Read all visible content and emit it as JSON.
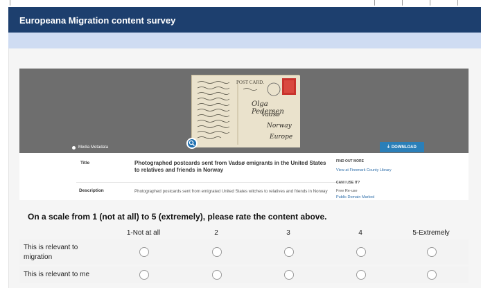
{
  "survey": {
    "title": "Europeana Migration content survey"
  },
  "media": {
    "metadata_label": "Media Metadata",
    "download_label": "DOWNLOAD",
    "postcard_header": "POST CARD.",
    "postcard_address": [
      "Olga Pedersen",
      "Vadsø",
      "Norway",
      "Europe"
    ]
  },
  "item": {
    "title_label": "Title",
    "title": "Photographed postcards sent from Vadsø emigrants in the United States to relatives and friends in Norway",
    "description_label": "Description",
    "description": "Photographed postcards sent from emigrated United States witches to relatives and friends in Norway",
    "find_out_more": "FIND OUT MORE",
    "view_at": "View at Finnmark County Library",
    "can_i_use": "CAN I USE IT?",
    "reuse": "Free Re-use",
    "license": "Public Domain Marked"
  },
  "rating": {
    "question": "On a scale from 1 (not at all) to 5 (extremely), please rate the content above.",
    "scale": [
      "1-Not at all",
      "2",
      "3",
      "4",
      "5-Extremely"
    ],
    "rows": [
      {
        "label": "This is relevant to migration"
      },
      {
        "label": "This is relevant to me"
      }
    ]
  }
}
